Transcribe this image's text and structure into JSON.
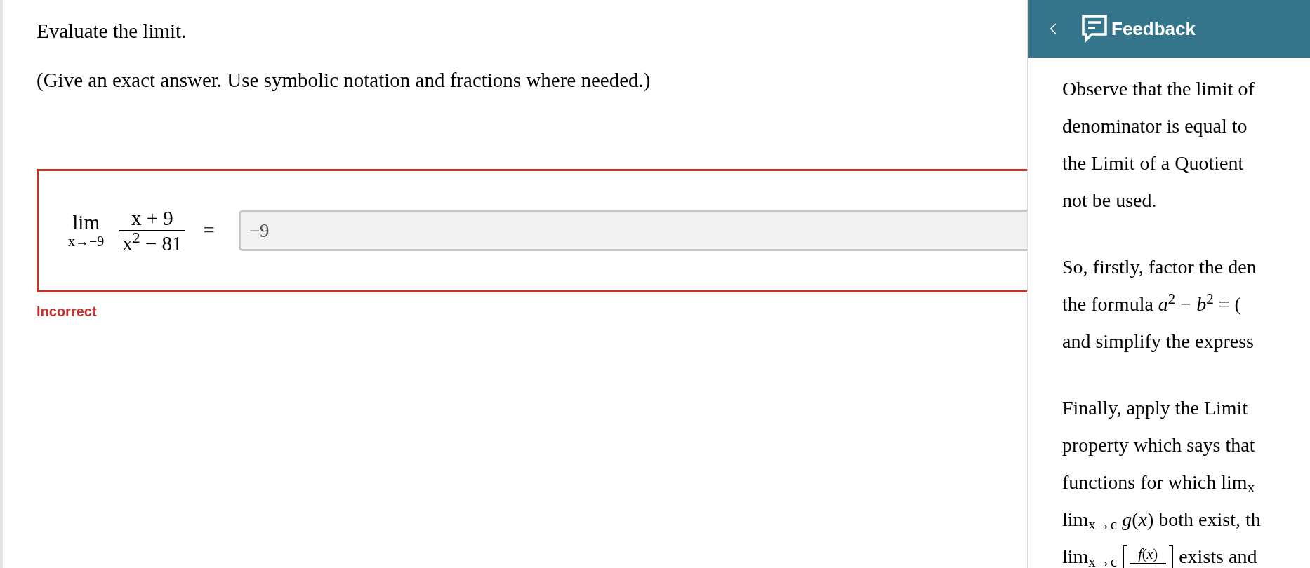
{
  "question": {
    "prompt": "Evaluate the limit.",
    "instructions": "(Give an exact answer. Use symbolic notation and fractions where needed.)",
    "expression": {
      "lim": "lim",
      "approach": "x→−9",
      "numerator": "x + 9",
      "denominator": "x$^{2}$ − 81",
      "equals": "="
    },
    "answer": {
      "value": "−9",
      "disabled": true
    },
    "correct": false,
    "status": "Incorrect"
  },
  "feedback": {
    "title": "Feedback",
    "paragraphs": [
      [
        {
          "kind": "text",
          "text": "Observe that the limit of"
        },
        {
          "kind": "text",
          "text": "denominator is equal to"
        },
        {
          "kind": "text",
          "text": "the Limit of a Quotient"
        },
        {
          "kind": "text",
          "text": "not be used."
        }
      ],
      [
        {
          "kind": "text",
          "text": "So, firstly, factor the den"
        },
        {
          "kind": "text",
          "text": "the formula *a*$^{2}$ − *b*$^{2}$ = ("
        },
        {
          "kind": "text",
          "text": "and simplify the express"
        }
      ],
      [
        {
          "kind": "text",
          "text": "Finally, apply the Limit"
        },
        {
          "kind": "text",
          "text": "property which says that"
        },
        {
          "kind": "text",
          "text": "functions for which lim$_{x}$"
        },
        {
          "kind": "text",
          "text": "lim$_{x→c}$ *g*(*x*) both exist, th"
        },
        {
          "kind": "fraction",
          "before": "lim$_{x→c}$",
          "numerator": "*f*(*x*)",
          "after": "exists and"
        }
      ]
    ]
  }
}
